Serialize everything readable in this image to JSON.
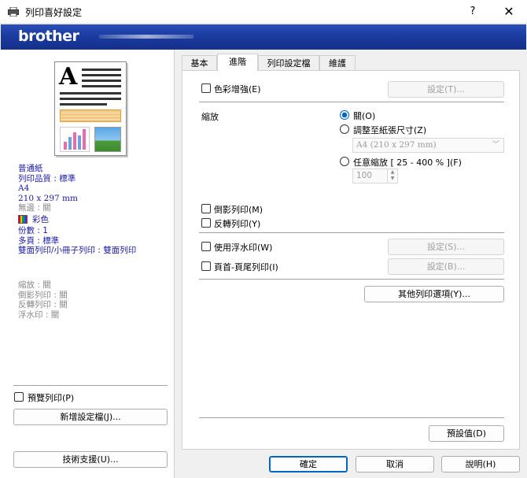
{
  "window": {
    "title": "列印喜好設定",
    "help": "?",
    "close": "✕"
  },
  "banner": {
    "logo": "brother"
  },
  "tabs": [
    {
      "label": "基本"
    },
    {
      "label": "進階"
    },
    {
      "label": "列印設定檔"
    },
    {
      "label": "維護"
    }
  ],
  "summary": {
    "media": "普通紙",
    "quality": "列印品質 : 標準",
    "paper": "A4",
    "paper_size": "210 x 297 mm",
    "borderless": "無邊 : 關",
    "color": "彩色",
    "copies": "份數 : 1",
    "multipage": "多頁 : 標準",
    "duplex": "雙面列印/小冊子列印 : 雙面列印",
    "scaling": "縮放 : 關",
    "mirror": "倒影列印 : 關",
    "reverse": "反轉列印 : 關",
    "watermark": "浮水印 : 關"
  },
  "left": {
    "preview_check": "預覽列印(P)",
    "add_profile": "新增設定檔(J)...",
    "support": "技術支援(U)..."
  },
  "advanced": {
    "color_enhance": "色彩增強(E)",
    "settings_t": "設定(T)...",
    "scaling_label": "縮放",
    "off": "關(O)",
    "fit_to_paper": "調整至紙張尺寸(Z)",
    "paper_combo": "A4 (210 x 297 mm)",
    "free_scale": "任意縮放 [ 25 - 400 % ](F)",
    "scale_value": "100",
    "mirror_print": "倒影列印(M)",
    "reverse_print": "反轉列印(Y)",
    "use_watermark": "使用浮水印(W)",
    "settings_s": "設定(S)...",
    "header_footer": "頁首-頁尾列印(I)",
    "settings_b": "設定(B)...",
    "other_options": "其他列印選項(Y)...",
    "defaults": "預設值(D)"
  },
  "footer": {
    "ok": "確定",
    "cancel": "取消",
    "help": "說明(H)"
  }
}
